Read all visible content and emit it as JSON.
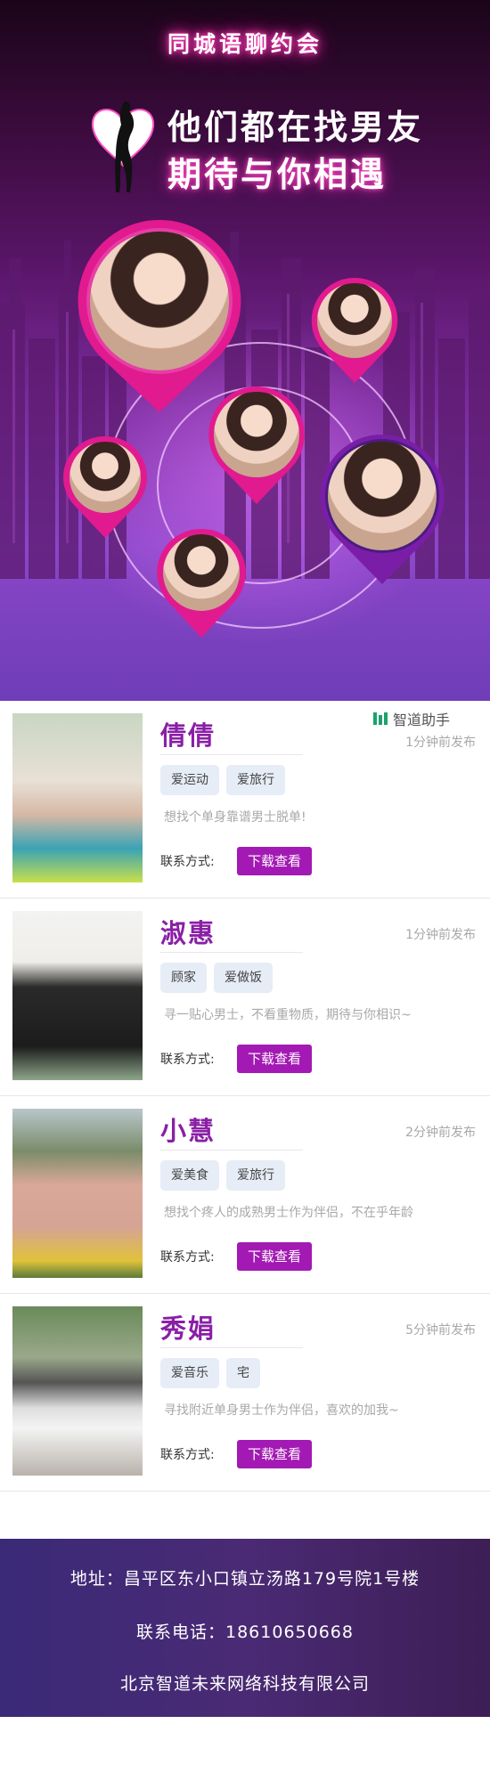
{
  "hero": {
    "event_title": "同城语聊约会",
    "headline_line1": "他们都在找男友",
    "headline_line2": "期待与你相遇",
    "accent_color": "#ff3fb6"
  },
  "watermark": {
    "text": "智道助手",
    "icon": "brand-logo-icon"
  },
  "profiles": [
    {
      "name": "倩倩",
      "time": "1分钟前发布",
      "tags": [
        "爱运动",
        "爱旅行"
      ],
      "bio": "想找个单身靠谱男士脱单!",
      "contact_label": "联系方式:",
      "button": "下载查看"
    },
    {
      "name": "淑惠",
      "time": "1分钟前发布",
      "tags": [
        "顾家",
        "爱做饭"
      ],
      "bio": "寻一贴心男士，不看重物质，期待与你相识~",
      "contact_label": "联系方式:",
      "button": "下载查看"
    },
    {
      "name": "小慧",
      "time": "2分钟前发布",
      "tags": [
        "爱美食",
        "爱旅行"
      ],
      "bio": "想找个疼人的成熟男士作为伴侣，不在乎年龄",
      "contact_label": "联系方式:",
      "button": "下载查看"
    },
    {
      "name": "秀娟",
      "time": "5分钟前发布",
      "tags": [
        "爱音乐",
        "宅"
      ],
      "bio": "寻找附近单身男士作为伴侣，喜欢的加我~",
      "contact_label": "联系方式:",
      "button": "下载查看"
    }
  ],
  "footer": {
    "address": "地址：昌平区东小口镇立汤路179号院1号楼",
    "phone": "联系电话：18610650668",
    "company": "北京智道未来网络科技有限公司"
  },
  "colors": {
    "name": "#8a1fa6",
    "button": "#a319b3",
    "tag_bg": "#e6edf6",
    "footer": "#3a2a78"
  }
}
